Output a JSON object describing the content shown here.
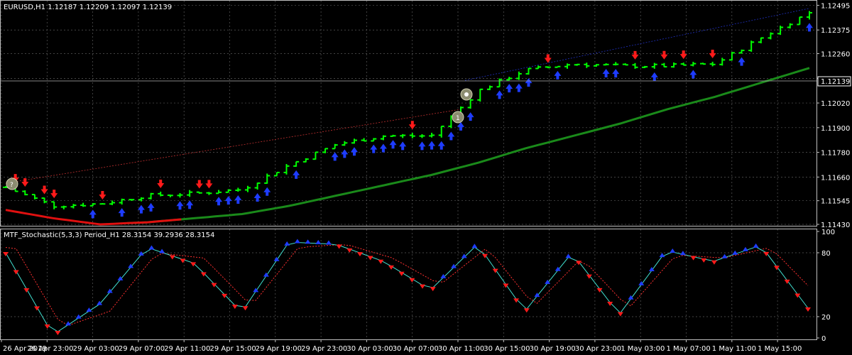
{
  "main_chart": {
    "title": "EURUSD,H1  1.12187 1.12209 1.12097 1.12139",
    "current_price": "1.12139",
    "price_ticks": [
      "1.12495",
      "1.12375",
      "1.12260",
      "1.12139",
      "1.12020",
      "1.11900",
      "1.11780",
      "1.11660",
      "1.11545",
      "1.11430"
    ]
  },
  "indicator": {
    "title": "MTF_Stochastic(5,3,3) Period_H1 28.3154 39.2936 28.3154",
    "level_ticks": [
      "100",
      "80",
      "20",
      "0"
    ]
  },
  "time_axis": {
    "labels": [
      "26 Apr 2019",
      "26 Apr 23:00",
      "29 Apr 03:00",
      "29 Apr 07:00",
      "29 Apr 11:00",
      "29 Apr 15:00",
      "29 Apr 19:00",
      "29 Apr 23:00",
      "30 Apr 03:00",
      "30 Apr 07:00",
      "30 Apr 11:00",
      "30 Apr 15:00",
      "30 Apr 19:00",
      "30 Apr 23:00",
      "1 May 03:00",
      "1 May 07:00",
      "1 May 11:00",
      "1 May 15:00"
    ]
  },
  "colors": {
    "background": "#000000",
    "grid": "#5a5a5a",
    "bar_up": "#00ff00",
    "arrow_up": "#1e3cff",
    "arrow_down": "#ff1a1a",
    "ma_line": "#1a8a1a",
    "stoch_main": "#40e0d0",
    "stoch_signal": "#ff3030"
  },
  "chart_data": [
    {
      "type": "ohlc",
      "title": "EURUSD,H1",
      "ylim": [
        1.1143,
        1.125
      ],
      "x": [
        "26 Apr 2019",
        "26 Apr 23:00",
        "29 Apr 03:00",
        "29 Apr 07:00",
        "29 Apr 11:00",
        "29 Apr 15:00",
        "29 Apr 19:00",
        "29 Apr 23:00",
        "30 Apr 03:00",
        "30 Apr 07:00",
        "30 Apr 11:00",
        "30 Apr 15:00",
        "30 Apr 19:00",
        "30 Apr 23:00",
        "1 May 03:00",
        "1 May 07:00",
        "1 May 11:00",
        "1 May 15:00"
      ],
      "close": [
        1.1161,
        1.1152,
        1.1153,
        1.1157,
        1.1158,
        1.116,
        1.1172,
        1.1182,
        1.1186,
        1.1186,
        1.1208,
        1.1218,
        1.1221,
        1.122,
        1.122,
        1.1221,
        1.1234,
        1.1246
      ],
      "ma_series": [
        1.115,
        1.1146,
        1.1143,
        1.1144,
        1.1146,
        1.1148,
        1.1152,
        1.1157,
        1.1162,
        1.1167,
        1.1173,
        1.118,
        1.1186,
        1.1192,
        1.1199,
        1.1205,
        1.1212,
        1.1219
      ]
    },
    {
      "type": "line",
      "title": "MTF_Stochastic(5,3,3) Period_H1",
      "ylim": [
        0,
        100
      ],
      "x": [
        "26 Apr 2019",
        "26 Apr 23:00",
        "29 Apr 03:00",
        "29 Apr 07:00",
        "29 Apr 11:00",
        "29 Apr 15:00",
        "29 Apr 19:00",
        "29 Apr 23:00",
        "30 Apr 03:00",
        "30 Apr 07:00",
        "30 Apr 11:00",
        "30 Apr 15:00",
        "30 Apr 19:00",
        "30 Apr 23:00",
        "1 May 03:00",
        "1 May 07:00",
        "1 May 11:00",
        "1 May 15:00"
      ],
      "main": [
        80,
        3,
        32,
        85,
        70,
        24,
        90,
        88,
        72,
        45,
        88,
        25,
        80,
        22,
        82,
        72,
        87,
        28
      ],
      "signal": [
        85,
        10,
        25,
        80,
        75,
        30,
        85,
        88,
        75,
        50,
        85,
        30,
        75,
        28,
        78,
        75,
        85,
        40
      ]
    }
  ]
}
